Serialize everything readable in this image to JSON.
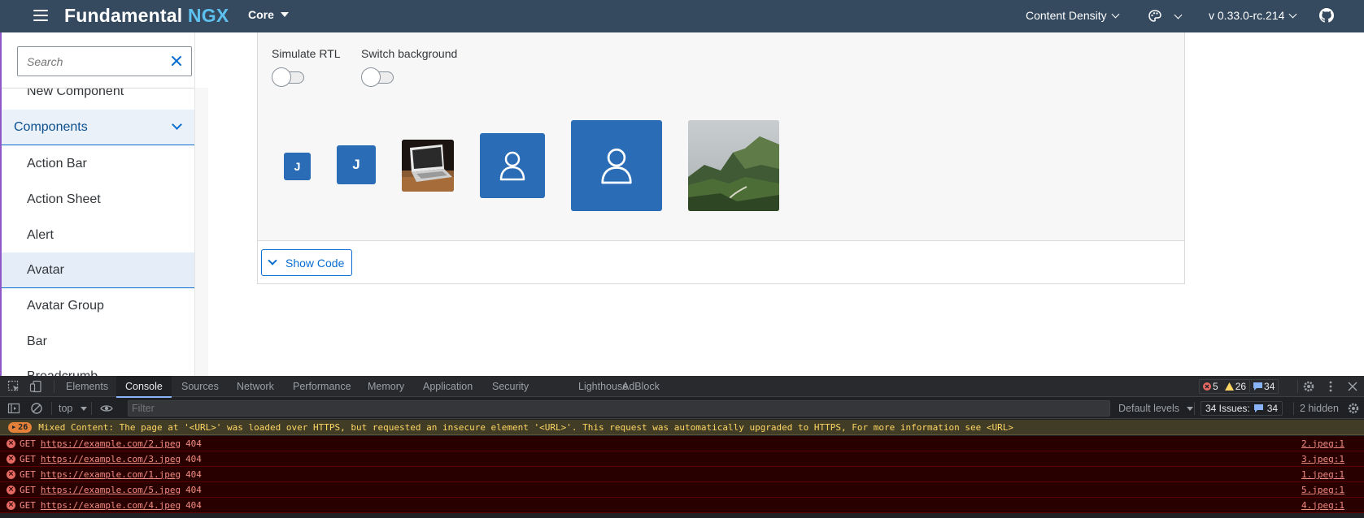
{
  "shellbar": {
    "brand_main": "Fundamental",
    "brand_suffix": "NGX",
    "product_menu": "Core",
    "content_density": "Content Density",
    "version": "v 0.33.0-rc.214",
    "colors": {
      "background": "#354a5f",
      "accent": "#5dc1f0"
    }
  },
  "sidebar": {
    "search_placeholder": "Search",
    "items": [
      {
        "label": "New Component",
        "kind": "item"
      },
      {
        "label": "Components",
        "kind": "section"
      },
      {
        "label": "Action Bar",
        "kind": "item"
      },
      {
        "label": "Action Sheet",
        "kind": "item"
      },
      {
        "label": "Alert",
        "kind": "item"
      },
      {
        "label": "Avatar",
        "kind": "selected"
      },
      {
        "label": "Avatar Group",
        "kind": "item"
      },
      {
        "label": "Bar",
        "kind": "item"
      },
      {
        "label": "Breadcrumb",
        "kind": "item"
      }
    ]
  },
  "example": {
    "simulate_rtl": "Simulate RTL",
    "switch_background": "Switch background",
    "avatars": [
      {
        "content": "J",
        "type": "initials"
      },
      {
        "content": "J",
        "type": "initials"
      },
      {
        "content": "laptop",
        "type": "image"
      },
      {
        "content": "person-icon",
        "type": "icon"
      },
      {
        "content": "person-icon",
        "type": "icon"
      },
      {
        "content": "landscape",
        "type": "image"
      }
    ],
    "show_code": "Show Code"
  },
  "devtools": {
    "tabs": [
      "Elements",
      "Console",
      "Sources",
      "Network",
      "Performance",
      "Memory",
      "Application",
      "Security",
      "Lighthouse",
      "AdBlock"
    ],
    "active_tab": "Console",
    "error_count": "5",
    "warning_count": "26",
    "info_count": "34",
    "context": "top",
    "filter_placeholder": "Filter",
    "levels": "Default levels",
    "issues_label": "34 Issues:",
    "issues_count": "34",
    "hidden": "2 hidden",
    "warning": {
      "count": "26",
      "text": "Mixed Content: The page at '<URL>' was loaded over HTTPS, but requested an insecure element '<URL>'. This request was automatically upgraded to HTTPS, For more information see <URL>"
    },
    "errors": [
      {
        "method": "GET",
        "url": "https://example.com/2.jpeg",
        "code": "404",
        "source": "2.jpeg:1"
      },
      {
        "method": "GET",
        "url": "https://example.com/3.jpeg",
        "code": "404",
        "source": "3.jpeg:1"
      },
      {
        "method": "GET",
        "url": "https://example.com/1.jpeg",
        "code": "404",
        "source": "1.jpeg:1"
      },
      {
        "method": "GET",
        "url": "https://example.com/5.jpeg",
        "code": "404",
        "source": "5.jpeg:1"
      },
      {
        "method": "GET",
        "url": "https://example.com/4.jpeg",
        "code": "404",
        "source": "4.jpeg:1"
      }
    ]
  }
}
